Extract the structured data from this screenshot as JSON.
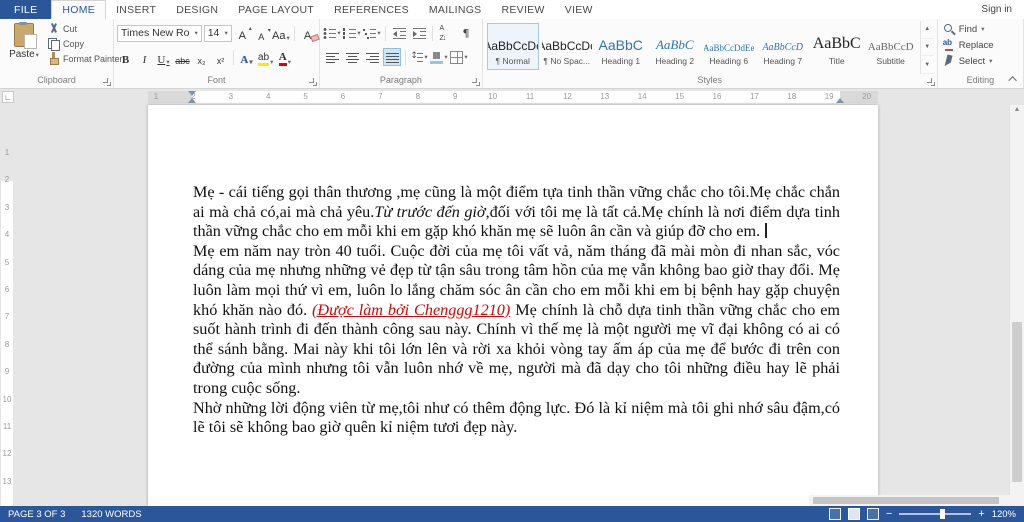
{
  "titlebar": {
    "sign_in": "Sign in"
  },
  "tabs": [
    {
      "label": "FILE",
      "file": true
    },
    {
      "label": "HOME",
      "active": true
    },
    {
      "label": "INSERT"
    },
    {
      "label": "DESIGN"
    },
    {
      "label": "PAGE LAYOUT"
    },
    {
      "label": "REFERENCES"
    },
    {
      "label": "MAILINGS"
    },
    {
      "label": "REVIEW"
    },
    {
      "label": "VIEW"
    }
  ],
  "ribbon": {
    "clipboard": {
      "label": "Clipboard",
      "paste": "Paste",
      "cut": "Cut",
      "copy": "Copy",
      "format_painter": "Format Painter"
    },
    "font": {
      "label": "Font",
      "family": "Times New Ro",
      "size": "14",
      "bold": "B",
      "italic": "I",
      "underline": "U",
      "strike": "abc",
      "subscript": "x₂",
      "superscript": "x²",
      "grow": "A",
      "shrink": "A",
      "case": "Aa",
      "clear": "A",
      "effects": "A",
      "highlight": "ab",
      "color": "A"
    },
    "paragraph": {
      "label": "Paragraph"
    },
    "styles": {
      "label": "Styles",
      "items": [
        {
          "preview": "AaBbCcDc",
          "name": "¶ Normal"
        },
        {
          "preview": "AaBbCcDc",
          "name": "¶ No Spac..."
        },
        {
          "preview": "AaBbC",
          "name": "Heading 1"
        },
        {
          "preview": "AaBbC",
          "name": "Heading 2"
        },
        {
          "preview": "AaBbCcDdEe",
          "name": "Heading 6"
        },
        {
          "preview": "AaBbCcD",
          "name": "Heading 7"
        },
        {
          "preview": "AaBbC",
          "name": "Title"
        },
        {
          "preview": "AaBbCcD",
          "name": "Subtitle"
        }
      ]
    },
    "editing": {
      "label": "Editing",
      "find": "Find",
      "replace": "Replace",
      "select": "Select"
    }
  },
  "ruler": {
    "horizontal": [
      1,
      2,
      3,
      4,
      5,
      6,
      7,
      8,
      9,
      10,
      11,
      12,
      13,
      14,
      15,
      16,
      17,
      18,
      19,
      20
    ],
    "vertical": [
      1,
      2,
      3,
      4,
      5,
      6,
      7,
      8,
      9,
      10,
      11,
      12,
      13
    ]
  },
  "document": {
    "paragraphs": [
      {
        "runs": [
          {
            "style": "normal",
            "text": "Mẹ - cái tiếng gọi thân thương ,mẹ cũng là một điểm tựa tinh thần vững chắc cho tôi.Mẹ chắc chắn ai mà chả có,ai mà chả yêu."
          },
          {
            "style": "italic",
            "text": "Từ trước đến giờ"
          },
          {
            "style": "normal",
            "text": ",đối với tôi mẹ là tất cả.Mẹ chính là nơi điểm dựa tinh thần vững chắc cho em mỗi khi em gặp khó khăn mẹ sẽ luôn ân cần và giúp đỡ cho em. "
          }
        ],
        "caret_after": true
      },
      {
        "runs": [
          {
            "style": "normal",
            "text": "Mẹ em năm nay tròn 40 tuổi. Cuộc đời của mẹ tôi vất vả, năm tháng đã mài mòn đi nhan sắc, vóc dáng của mẹ nhưng những vẻ đẹp từ tận sâu trong tâm hồn của mẹ vẫn không bao giờ thay đổi. Mẹ luôn làm mọi thứ vì em, luôn lo lắng chăm sóc ân cần cho em mỗi khi em bị bệnh hay gặp chuyện khó khăn nào đó. "
          },
          {
            "style": "red-italic-underline",
            "text": "(Được làm bởi Chenggg1210)"
          },
          {
            "style": "normal",
            "text": " Mẹ chính là chỗ dựa tinh thần vững chắc cho em suốt hành trình đi đến thành công sau này. Chính vì thế mẹ là một người mẹ vĩ đại không có ai có thể sánh bằng. Mai này khi tôi lớn lên và rời xa khỏi vòng tay ấm áp của mẹ để bước đi trên con đường của mình nhưng tôi vẫn luôn nhớ về mẹ, người mà đã dạy cho tôi những điều hay lẽ phải trong cuộc sống."
          }
        ]
      },
      {
        "runs": [
          {
            "style": "normal",
            "text": "Nhờ những lời động viên từ mẹ,tôi như có thêm động lực. Đó là kỉ niệm mà tôi ghi nhớ sâu đậm,có lẽ tôi sẽ không bao giờ quên kỉ niệm tươi đẹp này."
          }
        ]
      }
    ]
  },
  "statusbar": {
    "page": "PAGE 3 OF 3",
    "words": "1320 WORDS",
    "zoom": "120%"
  },
  "colors": {
    "accent": "#2b579a",
    "red_text": "#e00000",
    "heading_blue": "#2e74b5"
  }
}
